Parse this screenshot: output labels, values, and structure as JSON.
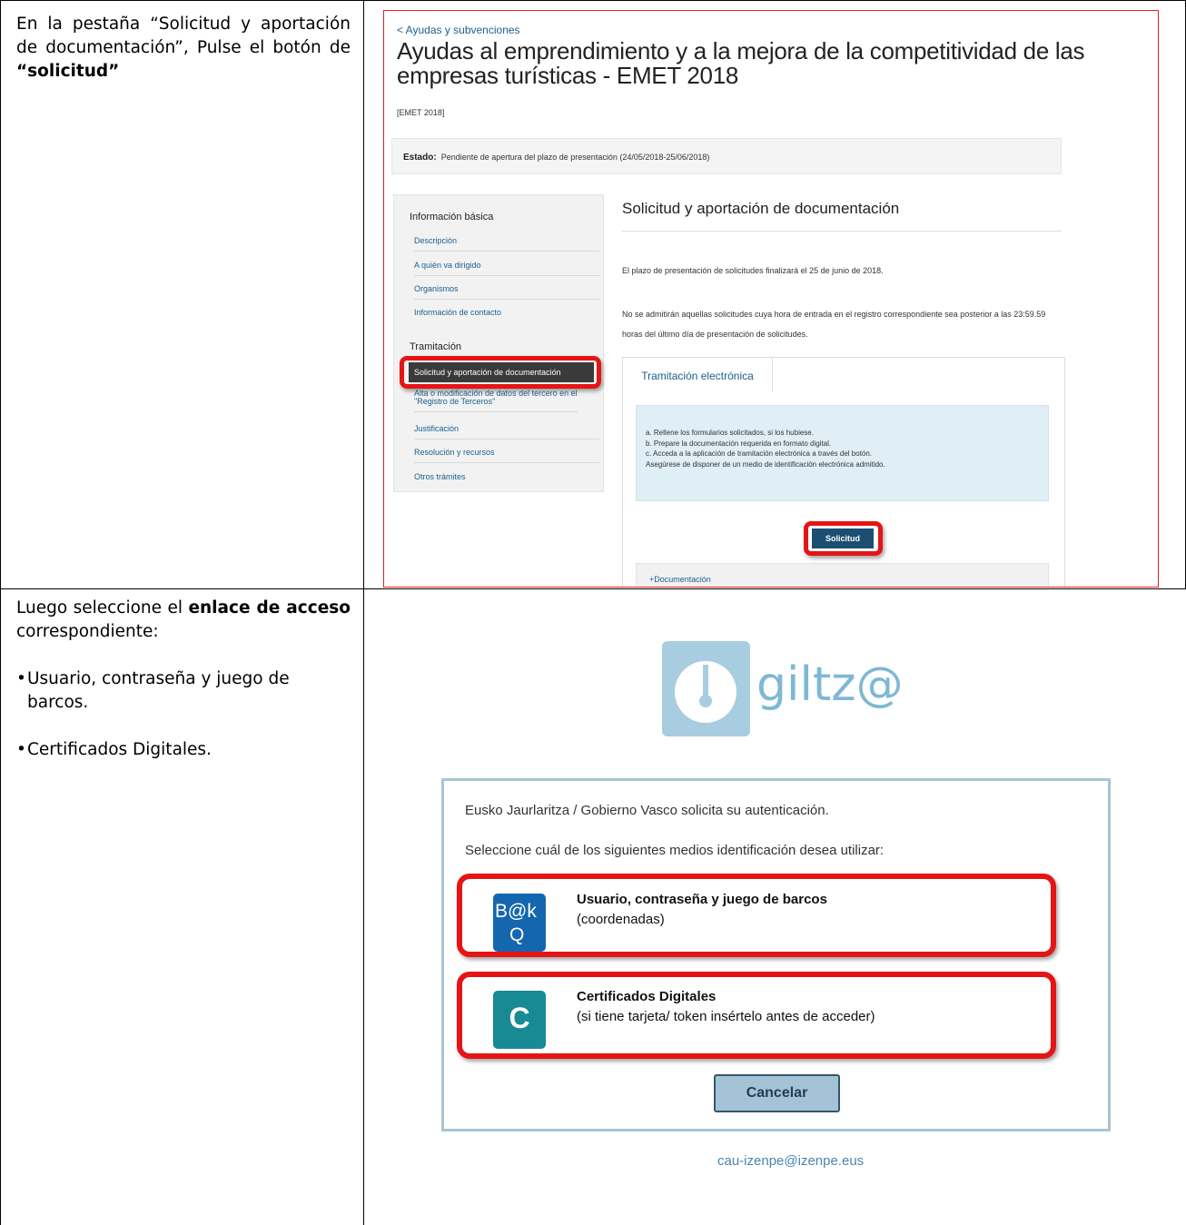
{
  "rows": [
    {
      "instruction": {
        "text_before": "En la pestaña “Solicitud y aportación de documentación”, Pulse el botón de ",
        "text_bold": "“solicitud”"
      }
    },
    {
      "instruction": {
        "intro_before": "Luego seleccione el ",
        "intro_bold": "enlace de acceso",
        "intro_after": " correspondiente:",
        "bullets": [
          "Usuario, contraseña y juego de barcos.",
          "Certificados Digitales."
        ]
      }
    }
  ],
  "screenshot1": {
    "breadcrumb": "< Ayudas y subvenciones",
    "title": "Ayudas al emprendimiento y a la mejora de la competitividad de las empresas turísticas - EMET 2018",
    "code": "[EMET 2018]",
    "estado_label": "Estado:",
    "estado_value": "Pendiente de apertura del plazo de presentación (24/05/2018-25/06/2018)",
    "sidebar": {
      "heading1": "Información básica",
      "items1": [
        "Descripción",
        "A quién va dirigido",
        "Organismos",
        "Información de contacto"
      ],
      "heading2": "Tramitación",
      "active": "Solicitud y aportación de documentación",
      "items2": [
        "Alta o modificación de datos del tercero en el \"Registro de Terceros\"",
        "Justificación",
        "Resolución y recursos",
        "Otros trámites"
      ]
    },
    "content": {
      "heading": "Solicitud y aportación de documentación",
      "para1": "El plazo de presentación de solicitudes finalizará el 25 de junio de 2018.",
      "para2": "No se admitirán aquellas solicitudes cuya hora de entrada en el registro correspondiente sea posterior a las 23:59.59 horas del último día de presentación de solicitudes.",
      "tab": "Tramitación electrónica",
      "steps": [
        "a.  Rellene los formularios solicitados, si los hubiese.",
        "b.  Prepare la documentación requerida en formato digital.",
        "c.  Acceda a la aplicación de tramitación electrónica a través del botón.",
        "      Asegúrese de disponer de un medio de identificación electrónica admitido."
      ],
      "button": "Solicitud",
      "documentacion": "+Documentación"
    }
  },
  "screenshot2": {
    "logo_text": "giltz@",
    "line1": "Eusko Jaurlaritza / Gobierno Vasco solicita su autenticación.",
    "line2": "Seleccione cuál de los siguientes medios identificación desea utilizar:",
    "option1": {
      "icon_text_top": "B@k",
      "icon_text_bottom": "Q",
      "title": "Usuario, contraseña y juego de barcos",
      "subtitle": "(coordenadas)",
      "color": "#1467ae"
    },
    "option2": {
      "icon_text": "C",
      "title": "Certificados Digitales",
      "subtitle": "(si tiene tarjeta/ token insértelo antes de acceder)",
      "color": "#178a94"
    },
    "cancel": "Cancelar",
    "email": "cau-izenpe@izenpe.eus"
  }
}
